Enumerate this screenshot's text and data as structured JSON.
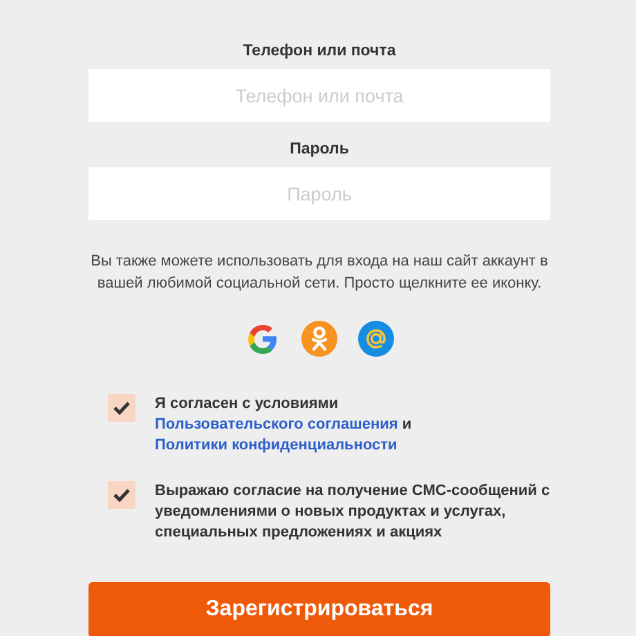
{
  "fields": [
    {
      "label": "Телефон или почта",
      "placeholder": "Телефон или почта"
    },
    {
      "label": "Пароль",
      "placeholder": "Пароль"
    }
  ],
  "social_hint": "Вы также можете использовать для входа на наш сайт аккаунт в вашей любимой социальной сети. Просто щелкните ее иконку.",
  "consents": [
    {
      "checked": true,
      "parts": [
        {
          "kind": "text",
          "text": "Я согласен с условиями "
        },
        {
          "kind": "link",
          "text": "Пользовательского соглашения"
        },
        {
          "kind": "text",
          "text": " и "
        },
        {
          "kind": "link",
          "text": "Политики конфиденциальности"
        }
      ]
    },
    {
      "checked": true,
      "parts": [
        {
          "kind": "text",
          "text": "Выражаю согласие на получение СМС-сообщений с уведомлениями о новых продуктах и услугах, специальных предложениях и акциях"
        }
      ]
    }
  ],
  "submit": "Зарегистрироваться"
}
